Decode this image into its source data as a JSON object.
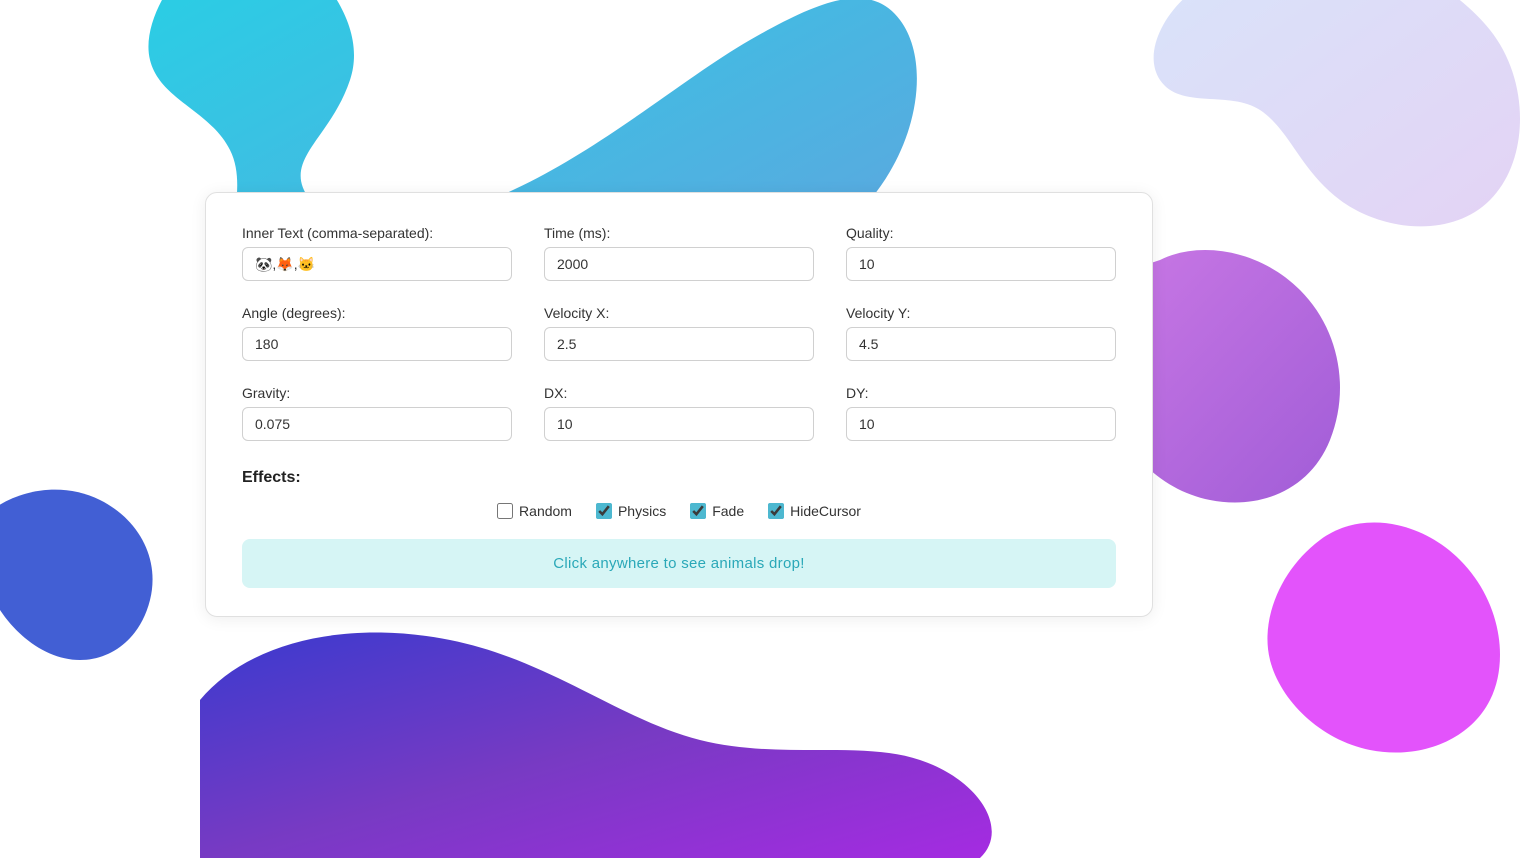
{
  "background": {
    "description": "Colorful blob background with cyan, blue, purple, magenta shapes"
  },
  "card": {
    "fields": {
      "inner_text": {
        "label": "Inner Text (comma-separated):",
        "value": "🐼,🦊,🐱"
      },
      "time_ms": {
        "label": "Time (ms):",
        "value": "2000"
      },
      "quality": {
        "label": "Quality:",
        "value": "10"
      },
      "angle": {
        "label": "Angle (degrees):",
        "value": "180"
      },
      "velocity_x": {
        "label": "Velocity X:",
        "value": "2.5"
      },
      "velocity_y": {
        "label": "Velocity Y:",
        "value": "4.5"
      },
      "gravity": {
        "label": "Gravity:",
        "value": "0.075"
      },
      "dx": {
        "label": "DX:",
        "value": "10"
      },
      "dy": {
        "label": "DY:",
        "value": "10"
      }
    },
    "effects": {
      "title": "Effects:",
      "items": [
        {
          "label": "Random",
          "checked": false
        },
        {
          "label": "Physics",
          "checked": true
        },
        {
          "label": "Fade",
          "checked": true
        },
        {
          "label": "HideCursor",
          "checked": true
        }
      ]
    },
    "cta": "Click anywhere to see animals drop!"
  }
}
